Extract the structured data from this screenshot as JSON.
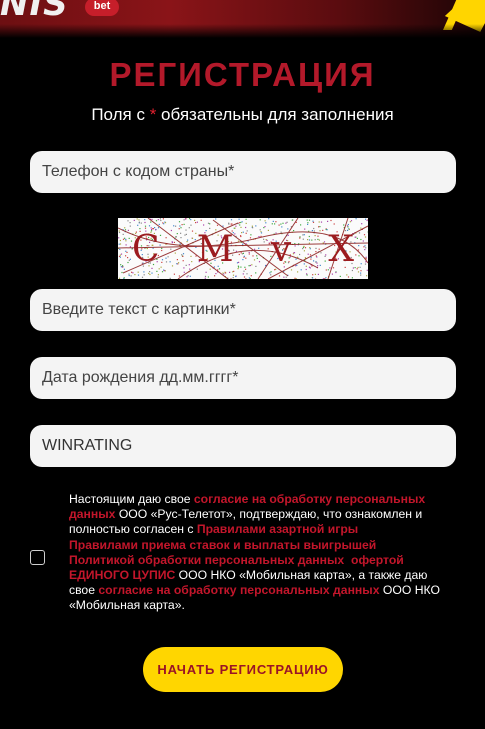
{
  "header": {
    "logo_text": "NIS",
    "logo_badge": "bet"
  },
  "form": {
    "title": "РЕГИСТРАЦИЯ",
    "required_note": {
      "before": "Поля с ",
      "star": "*",
      "after": " обязательны для заполнения"
    },
    "phone_placeholder": "Телефон с кодом страны*",
    "captcha": {
      "image_text": "C M v X"
    },
    "captcha_input_placeholder": "Введите текст с картинки*",
    "birthdate_placeholder": "Дата рождения дд.мм.гггг*",
    "promo_value": "WINRATING",
    "consent": {
      "t1": "Настоящим даю свое ",
      "link1": "согласие на обработку персональных данных",
      "t2": " ООО «Рус-Телетот», подтверждаю, что ознакомлен и полностью согласен с ",
      "link2": "Правилами азартной игры",
      "link3": "Правилами приема ставок и выплаты выигрышей",
      "link4": "Политикой обработки персональных данных",
      "link5": "офертой ЕДИНОГО ЦУПИС",
      "t3": " ООО НКО «Мобильная карта», а также даю свое ",
      "link6": "согласие на обработку персональных данных",
      "t4": " ООО НКО «Мобильная карта»."
    },
    "submit_label": "НАЧАТЬ РЕГИСТРАЦИЮ"
  },
  "colors": {
    "title_red": "#b3192a",
    "link_red": "#c3162b",
    "button_yellow": "#ffd600",
    "background": "#000000"
  }
}
